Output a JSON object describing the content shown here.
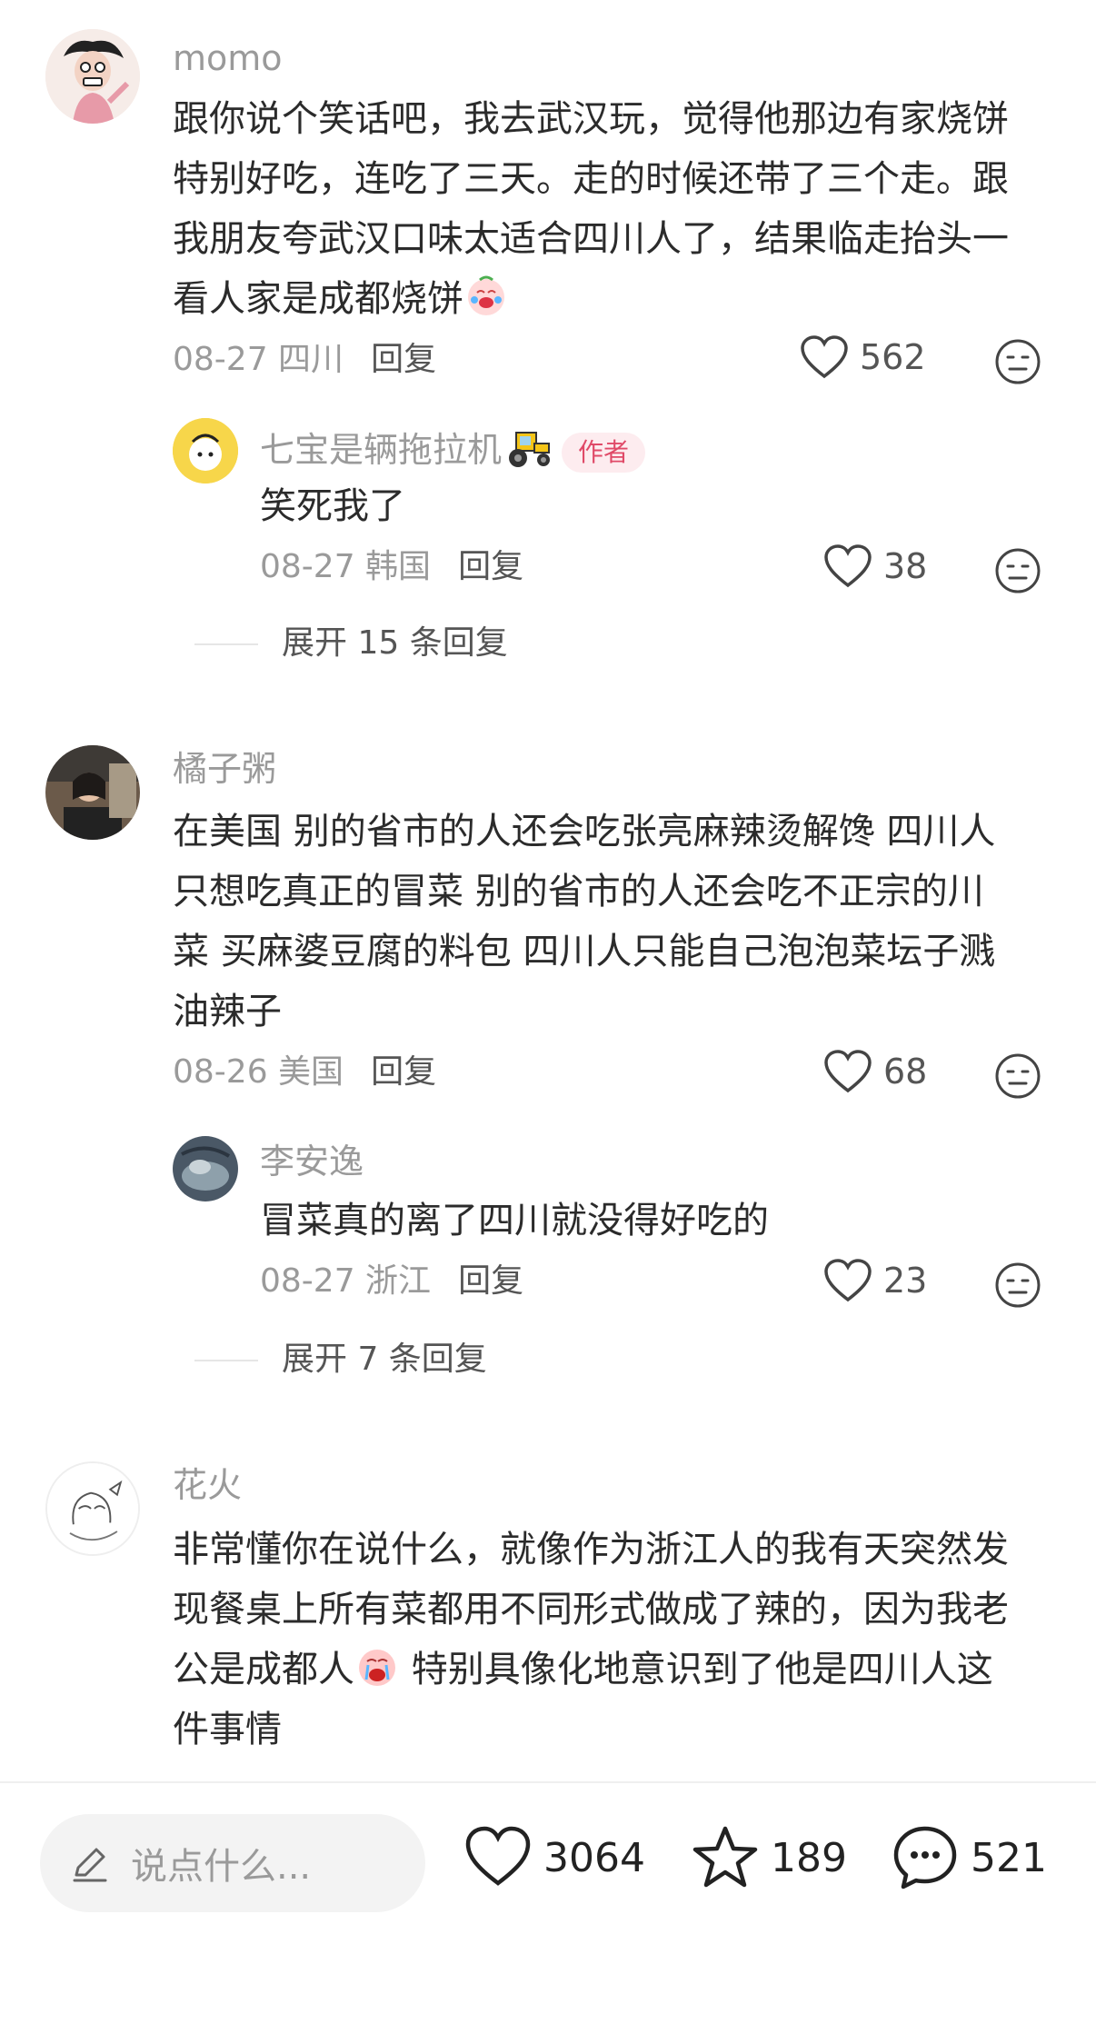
{
  "comments": [
    {
      "username": "momo",
      "lines": [
        "跟你说个笑话吧，我去武汉玩，觉得他那边有家烧饼",
        "特别好吃，连吃了三天。走的时候还带了三个走。跟",
        "我朋友夸武汉口味太适合四川人了，结果临走抬头一",
        "看人家是成都烧饼"
      ],
      "emoji": "crying-laughing-emoji",
      "date_loc": "08-27 四川",
      "reply_label": "回复",
      "likes": "562",
      "reply": {
        "username": "七宝是辆拖拉机",
        "username_emoji": "tractor-emoji",
        "badge": "作者",
        "text": "笑死我了",
        "date_loc": "08-27 韩国",
        "reply_label": "回复",
        "likes": "38"
      },
      "expand_label": "展开 15 条回复"
    },
    {
      "username": "橘子粥",
      "lines": [
        "在美国 别的省市的人还会吃张亮麻辣烫解馋 四川人",
        "只想吃真正的冒菜 别的省市的人还会吃不正宗的川",
        "菜 买麻婆豆腐的料包 四川人只能自己泡泡菜坛子溅",
        "油辣子"
      ],
      "date_loc": "08-26 美国",
      "reply_label": "回复",
      "likes": "68",
      "reply": {
        "username": "李安逸",
        "text": "冒菜真的离了四川就没得好吃的",
        "date_loc": "08-27 浙江",
        "reply_label": "回复",
        "likes": "23"
      },
      "expand_label": "展开 7 条回复"
    },
    {
      "username": "花火",
      "lines": [
        "非常懂你在说什么，就像作为浙江人的我有天突然发",
        "现餐桌上所有菜都用不同形式做成了辣的，因为我老",
        "公是成都人",
        "件事情"
      ],
      "line3_suffix": " 特别具像化地意识到了他是四川人这",
      "emoji": "crying-emoji"
    }
  ],
  "bottom_bar": {
    "input_placeholder": "说点什么...",
    "likes": "3064",
    "favorites": "189",
    "comments": "521"
  },
  "colors": {
    "username": "#9a9a9a",
    "badge_bg": "#fdecef",
    "badge_text": "#e04a68",
    "text": "#2b2b2b"
  }
}
